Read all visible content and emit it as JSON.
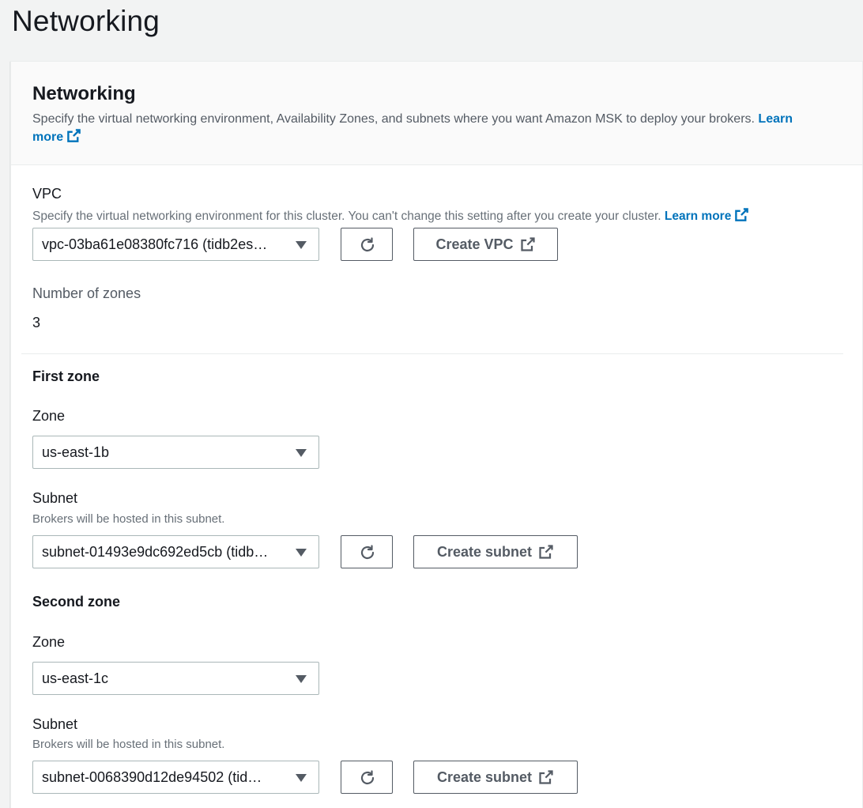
{
  "page": {
    "title": "Networking"
  },
  "panel": {
    "title": "Networking",
    "description": "Specify the virtual networking environment, Availability Zones, and subnets where you want Amazon MSK to deploy your brokers.",
    "learn_more": "Learn more"
  },
  "vpc": {
    "label": "VPC",
    "description": "Specify the virtual networking environment for this cluster. You can't change this setting after you create your cluster.",
    "learn_more": "Learn more",
    "selected": "vpc-03ba61e08380fc716 (tidb2es…",
    "create_button": "Create VPC"
  },
  "zones": {
    "label": "Number of zones",
    "value": "3"
  },
  "first_zone": {
    "heading": "First zone",
    "zone_label": "Zone",
    "zone_value": "us-east-1b",
    "subnet_label": "Subnet",
    "subnet_hint": "Brokers will be hosted in this subnet.",
    "subnet_value": "subnet-01493e9dc692ed5cb (tidb…",
    "create_button": "Create subnet"
  },
  "second_zone": {
    "heading": "Second zone",
    "zone_label": "Zone",
    "zone_value": "us-east-1c",
    "subnet_label": "Subnet",
    "subnet_hint": "Brokers will be hosted in this subnet.",
    "subnet_value": "subnet-0068390d12de94502 (tid…",
    "create_button": "Create subnet"
  },
  "icons": {
    "refresh": "refresh-icon",
    "external": "external-link-icon",
    "caret": "caret-down-icon"
  },
  "colors": {
    "link": "#0073bb",
    "button_text": "#545b64",
    "background": "#f2f3f3"
  }
}
